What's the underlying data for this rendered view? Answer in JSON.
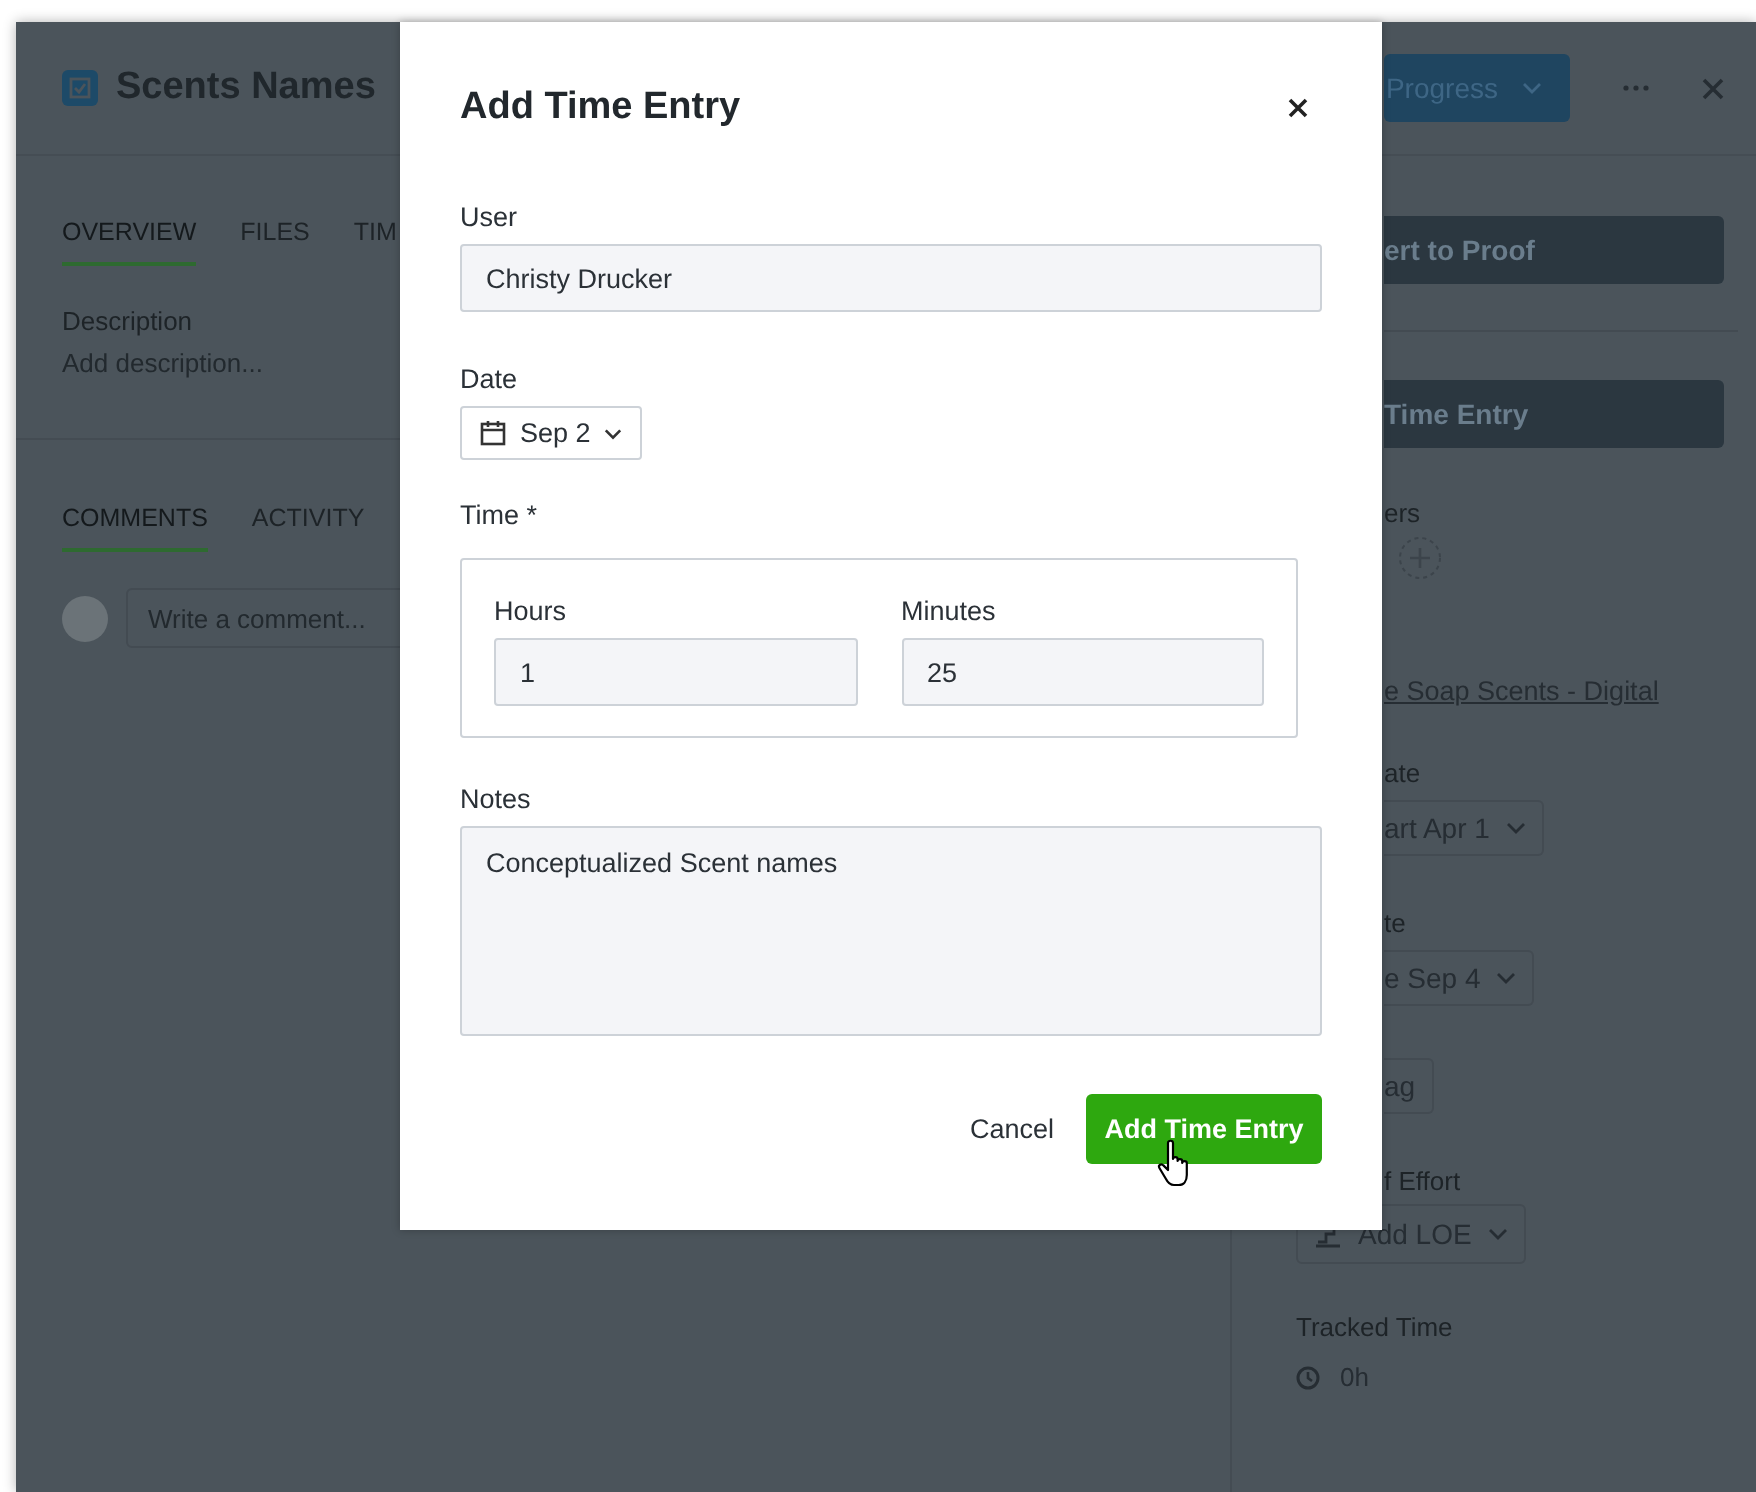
{
  "header": {
    "title": "Scents Names",
    "status_button": "Progress"
  },
  "tabs": [
    {
      "label": "OVERVIEW",
      "selected": true
    },
    {
      "label": "FILES",
      "selected": false
    },
    {
      "label": "TIM",
      "selected": false
    }
  ],
  "description": {
    "label": "Description",
    "placeholder": "Add description..."
  },
  "comment_tabs": [
    {
      "label": "COMMENTS",
      "selected": true
    },
    {
      "label": "ACTIVITY",
      "selected": false
    }
  ],
  "comment_field": {
    "placeholder": "Write a comment..."
  },
  "sidebar": {
    "convert_button": "ert to Proof",
    "time_entry_button": "Time Entry",
    "followers_label": "ers",
    "project_link": "e Soap Scents - Digital",
    "start_date_label": "ate",
    "start_date": "art Apr 1",
    "due_date_label": "te",
    "due_date": "e Sep 4",
    "tag_button": "ag",
    "effort_label": "f Effort",
    "effort_button": "Add LOE",
    "tracked_label": "Tracked Time",
    "tracked_value": "0h"
  },
  "dialog": {
    "title": "Add Time Entry",
    "user": {
      "label": "User",
      "value": "Christy Drucker"
    },
    "date": {
      "label": "Date",
      "value": "Sep 2"
    },
    "time": {
      "label": "Time *",
      "hours": {
        "label": "Hours",
        "value": "1"
      },
      "minutes": {
        "label": "Minutes",
        "value": "25"
      }
    },
    "notes": {
      "label": "Notes",
      "value": "Conceptualized Scent names"
    },
    "cancel": "Cancel",
    "submit": "Add Time Entry"
  }
}
